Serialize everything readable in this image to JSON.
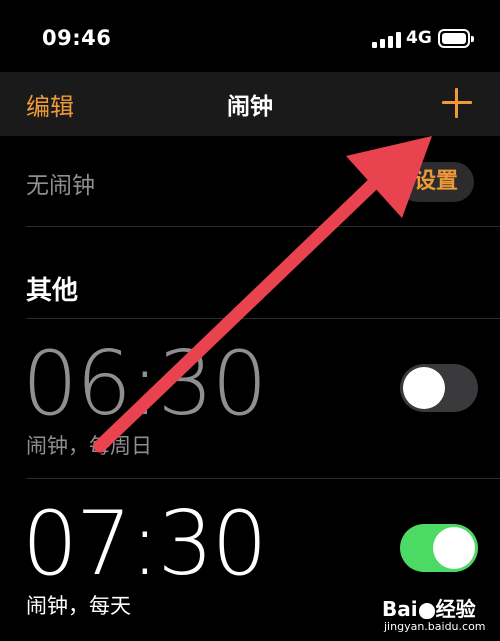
{
  "status_bar": {
    "time": "09:46",
    "network": "4G"
  },
  "nav": {
    "edit_label": "编辑",
    "title": "闹钟"
  },
  "sleep": {
    "label": "无闹钟",
    "button_label": "设置"
  },
  "section": {
    "title": "其他"
  },
  "alarms": [
    {
      "time": "06:30",
      "subtitle": "闹钟，每周日",
      "enabled": false
    },
    {
      "time": "07:30",
      "subtitle": "闹钟，每天",
      "enabled": true
    }
  ],
  "watermark": {
    "main_left": "Bai",
    "main_right": "经验",
    "sub": "jingyan.baidu.com"
  },
  "colors": {
    "accent": "#f09a37",
    "toggle_on": "#4cd964",
    "toggle_off": "#3a3a3c",
    "annotation_arrow": "#e8434f"
  }
}
